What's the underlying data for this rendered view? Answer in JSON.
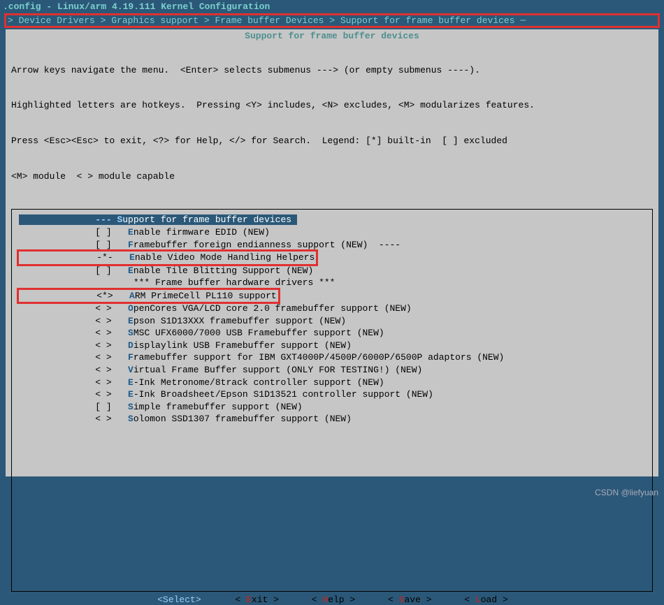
{
  "title": ".config - Linux/arm 4.19.111 Kernel Configuration",
  "breadcrumb": " > Device Drivers > Graphics support > Frame buffer Devices > Support for frame buffer devices ─",
  "subtitle": "Support for frame buffer devices",
  "help_lines": [
    "Arrow keys navigate the menu.  <Enter> selects submenus ---> (or empty submenus ----).",
    "Highlighted letters are hotkeys.  Pressing <Y> includes, <N> excludes, <M> modularizes features.",
    "Press <Esc><Esc> to exit, <?> for Help, </> for Search.  Legend: [*] built-in  [ ] excluded",
    "<M> module  < > module capable"
  ],
  "rows": [
    {
      "mark": "---",
      "hot": "S",
      "text": "upport for frame buffer devices",
      "selected": true
    },
    {
      "mark": "[ ]",
      "hot": "E",
      "text": "nable firmware EDID (NEW)"
    },
    {
      "mark": "[ ]",
      "hot": "F",
      "text": "ramebuffer foreign endianness support (NEW)  ----"
    },
    {
      "mark": "-*-",
      "hot": "E",
      "text": "nable Video Mode Handling Helpers",
      "boxed": true
    },
    {
      "mark": "[ ]",
      "hot": "E",
      "text": "nable Tile Blitting Support (NEW)"
    },
    {
      "mark": "   ",
      "hot": " ",
      "text": "*** Frame buffer hardware drivers ***"
    },
    {
      "mark": "<*>",
      "hot": "A",
      "text": "RM PrimeCell PL110 support",
      "boxed": true
    },
    {
      "mark": "< >",
      "hot": "O",
      "text": "penCores VGA/LCD core 2.0 framebuffer support (NEW)"
    },
    {
      "mark": "< >",
      "hot": "E",
      "text": "pson S1D13XXX framebuffer support (NEW)"
    },
    {
      "mark": "< >",
      "hot": "S",
      "text": "MSC UFX6000/7000 USB Framebuffer support (NEW)"
    },
    {
      "mark": "< >",
      "hot": "D",
      "text": "isplaylink USB Framebuffer support (NEW)"
    },
    {
      "mark": "< >",
      "hot": "F",
      "text": "ramebuffer support for IBM GXT4000P/4500P/6000P/6500P adaptors (NEW)"
    },
    {
      "mark": "< >",
      "hot": "V",
      "text": "irtual Frame Buffer support (ONLY FOR TESTING!) (NEW)"
    },
    {
      "mark": "< >",
      "hot": "E",
      "text": "-Ink Metronome/8track controller support (NEW)"
    },
    {
      "mark": "< >",
      "hot": "E",
      "text": "-Ink Broadsheet/Epson S1D13521 controller support (NEW)"
    },
    {
      "mark": "[ ]",
      "hot": "S",
      "text": "imple framebuffer support (NEW)"
    },
    {
      "mark": "< >",
      "hot": "S",
      "text": "olomon SSD1307 framebuffer support (NEW)"
    }
  ],
  "buttons": {
    "select": "<Select>",
    "exit_pre": "< ",
    "exit_k": "E",
    "exit_rest": "xit >",
    "help_pre": "< ",
    "help_k": "H",
    "help_rest": "elp >",
    "save_pre": "< ",
    "save_k": "S",
    "save_rest": "ave >",
    "load_pre": "< ",
    "load_k": "L",
    "load_rest": "oad >"
  },
  "watermark": "CSDN @liefyuan"
}
